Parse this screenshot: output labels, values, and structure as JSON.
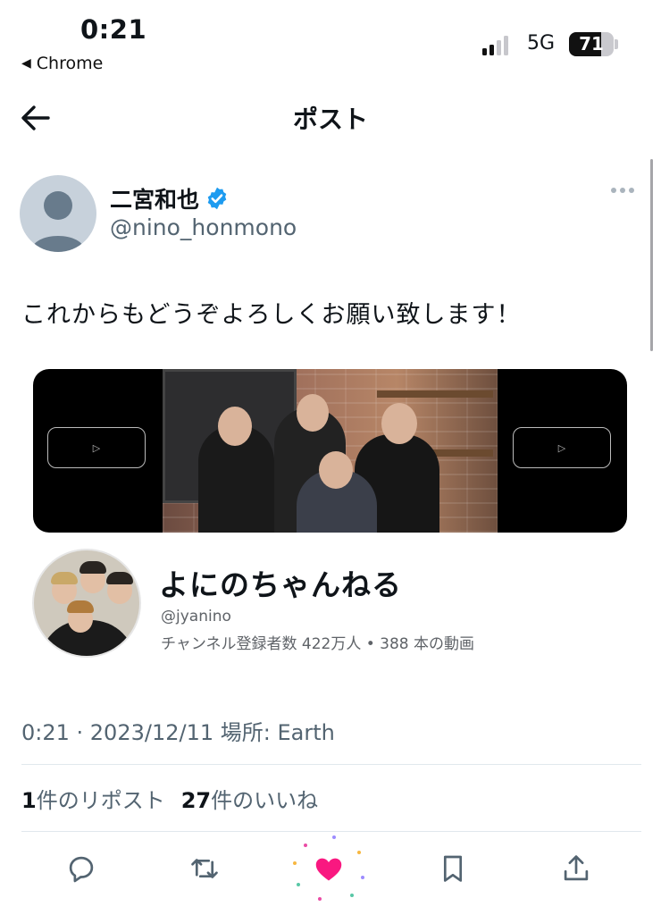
{
  "status_bar": {
    "time": "0:21",
    "back_app": "Chrome",
    "network": "5G",
    "battery": "71",
    "battery_level": 0.71
  },
  "header": {
    "title": "ポスト"
  },
  "post": {
    "author_name": "二宮和也",
    "author_handle": "@nino_honmono",
    "text": "これからもどうぞよろしくお願い致します！",
    "meta": "0:21 · 2023/12/11 場所: Earth"
  },
  "channel_card": {
    "name": "よにのちゃんねる",
    "handle": "@jyanino",
    "stats": "チャンネル登録者数 422万人 • 388 本の動画"
  },
  "engagement": {
    "reposts_count": "1",
    "reposts_label": "件のリポスト",
    "likes_count": "27",
    "likes_label": "件のいいね"
  },
  "colors": {
    "verified": "#1d9bf0",
    "like_active": "#f91880",
    "secondary_text": "#536471"
  },
  "icons": [
    "back-arrow-icon",
    "verified-badge-icon",
    "more-icon",
    "reply-icon",
    "repost-icon",
    "like-icon",
    "bookmark-icon",
    "share-icon"
  ]
}
